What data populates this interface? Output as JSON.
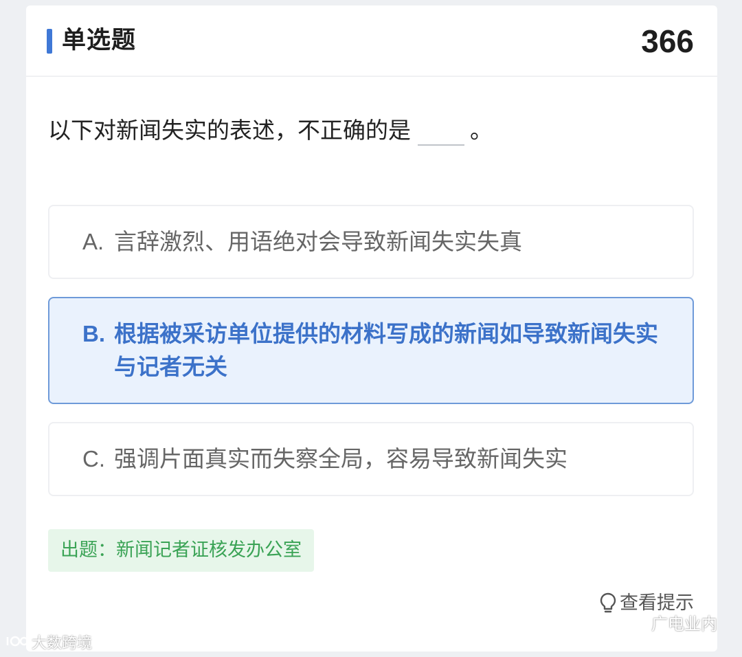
{
  "header": {
    "title": "单选题",
    "number": "366"
  },
  "question": {
    "text_before": "以下对新闻失实的表述，不正确的是",
    "text_after": "。"
  },
  "options": [
    {
      "letter": "A.",
      "text": "言辞激烈、用语绝对会导致新闻失实失真",
      "selected": false
    },
    {
      "letter": "B.",
      "text": "根据被采访单位提供的材料写成的新闻如导致新闻失实与记者无关",
      "selected": true
    },
    {
      "letter": "C.",
      "text": "强调片面真实而失察全局，容易导致新闻失实",
      "selected": false
    }
  ],
  "source": {
    "text": "出题：新闻记者证核发办公室"
  },
  "hint": {
    "label": "查看提示",
    "icon": "lightbulb-icon"
  },
  "watermarks": {
    "left": "大数跨境",
    "right": "广电业内"
  },
  "colors": {
    "accent": "#3f78d6",
    "selected_text": "#3c72c9",
    "selected_bg": "#eaf2fd",
    "source_green": "#3aa355",
    "source_bg": "#e7f6ea"
  }
}
